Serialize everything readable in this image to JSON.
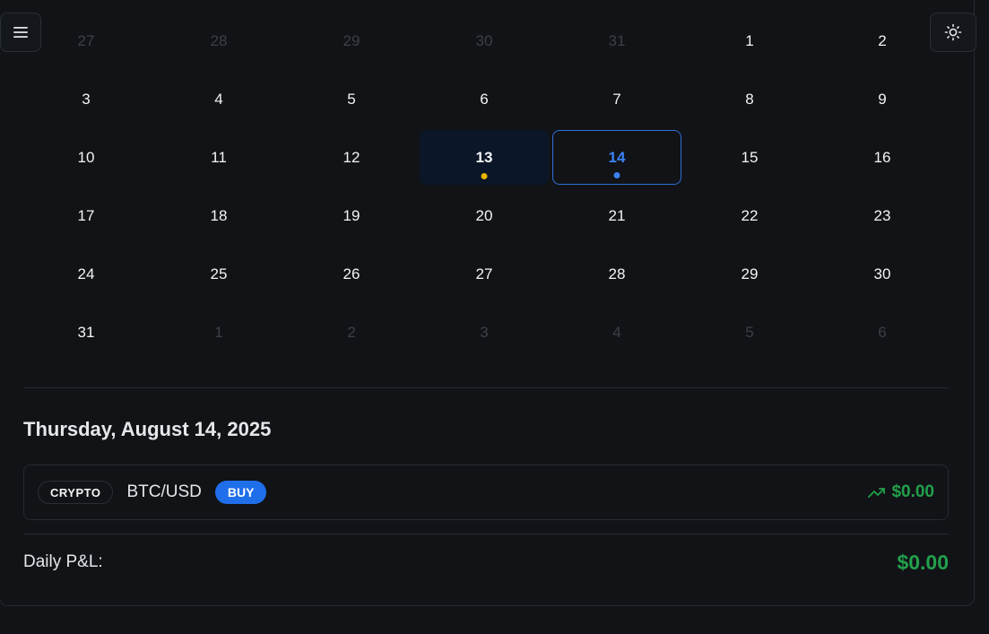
{
  "calendar": {
    "weeks": [
      [
        {
          "d": "27",
          "other": true
        },
        {
          "d": "28",
          "other": true
        },
        {
          "d": "29",
          "other": true
        },
        {
          "d": "30",
          "other": true
        },
        {
          "d": "31",
          "other": true
        },
        {
          "d": "1"
        },
        {
          "d": "2"
        }
      ],
      [
        {
          "d": "3"
        },
        {
          "d": "4"
        },
        {
          "d": "5"
        },
        {
          "d": "6"
        },
        {
          "d": "7"
        },
        {
          "d": "8"
        },
        {
          "d": "9"
        }
      ],
      [
        {
          "d": "10"
        },
        {
          "d": "11"
        },
        {
          "d": "12"
        },
        {
          "d": "13",
          "today": true,
          "dot": "#e8b400"
        },
        {
          "d": "14",
          "selected": true,
          "dot": "#3b82f6"
        },
        {
          "d": "15"
        },
        {
          "d": "16"
        }
      ],
      [
        {
          "d": "17"
        },
        {
          "d": "18"
        },
        {
          "d": "19"
        },
        {
          "d": "20"
        },
        {
          "d": "21"
        },
        {
          "d": "22"
        },
        {
          "d": "23"
        }
      ],
      [
        {
          "d": "24"
        },
        {
          "d": "25"
        },
        {
          "d": "26"
        },
        {
          "d": "27"
        },
        {
          "d": "28"
        },
        {
          "d": "29"
        },
        {
          "d": "30"
        }
      ],
      [
        {
          "d": "31"
        },
        {
          "d": "1",
          "other": true
        },
        {
          "d": "2",
          "other": true
        },
        {
          "d": "3",
          "other": true
        },
        {
          "d": "4",
          "other": true
        },
        {
          "d": "5",
          "other": true
        },
        {
          "d": "6",
          "other": true
        }
      ]
    ]
  },
  "selected_date_title": "Thursday, August 14, 2025",
  "trade": {
    "type": "CRYPTO",
    "symbol": "BTC/USD",
    "side": "BUY",
    "pnl": "$0.00",
    "pnl_icon": "trending-up-icon"
  },
  "daily": {
    "label": "Daily P&L:",
    "value": "$0.00"
  },
  "icons": {
    "menu": "menu-icon",
    "theme": "sun-icon"
  },
  "colors": {
    "accent": "#3b82f6",
    "profit": "#22a04b",
    "buy": "#1f6feb",
    "today_dot": "#e8b400"
  }
}
